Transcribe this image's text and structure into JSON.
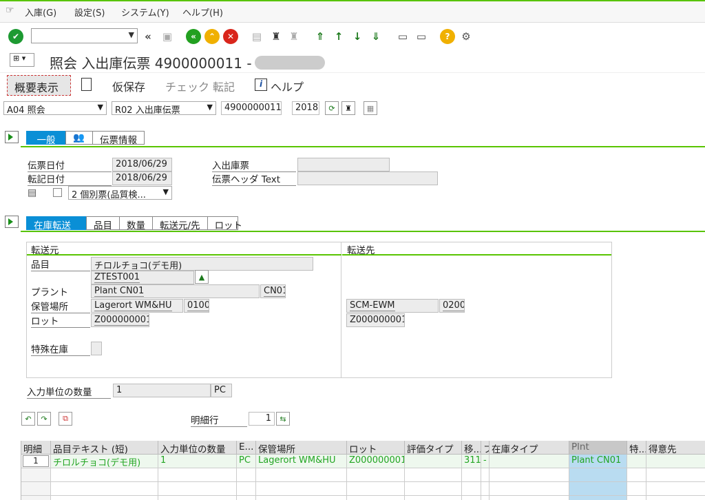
{
  "menu": {
    "items": [
      "入庫(G)",
      "設定(S)",
      "システム(Y)",
      "ヘルプ(H)"
    ]
  },
  "toolbar": {
    "command_value": ""
  },
  "title": {
    "text": "照会 入出庫伝票 4900000011 -"
  },
  "appbar": {
    "overview": "概要表示",
    "hold": "仮保存",
    "check": "チェック",
    "post": "転記",
    "help": "ヘルプ"
  },
  "header": {
    "action": "A04 照会",
    "ref_doc": "R02 入出庫伝票",
    "doc_number": "4900000011",
    "year": "2018"
  },
  "tabs_top": [
    "一般",
    "伝票情報"
  ],
  "general": {
    "doc_date_label": "伝票日付",
    "doc_date": "2018/06/29",
    "post_date_label": "転記日付",
    "post_date": "2018/06/29",
    "slip_label": "入出庫票",
    "slip_value": "",
    "header_text_label": "伝票ヘッダ Text",
    "header_text_value": "",
    "print_option": "2 個別票(品質検..."
  },
  "tabs_item": [
    "在庫転送",
    "品目",
    "数量",
    "転送元/先",
    "ロット"
  ],
  "transfer": {
    "from_title": "転送元",
    "to_title": "転送先",
    "material_label": "品目",
    "material_desc": "チロルチョコ(デモ用)",
    "material": "ZTEST001",
    "plant_label": "プラント",
    "plant_name": "Plant CN01",
    "plant": "CN01",
    "sloc_label": "保管場所",
    "sloc_name": "Lagerort WM&HU",
    "sloc": "0100",
    "batch_label": "ロット",
    "batch": "Z000000001",
    "special_stock_label": "特殊在庫",
    "to_sloc_name": "SCM-EWM",
    "to_sloc": "0200",
    "to_batch": "Z000000001"
  },
  "quantity": {
    "label": "入力単位の数量",
    "value": "1",
    "unit": "PC"
  },
  "lineitem": {
    "label": "明細行",
    "value": "1"
  },
  "grid": {
    "columns": [
      "明細",
      "品目テキスト (短)",
      "入力単位の数量",
      "E...",
      "保管場所",
      "ロット",
      "評価タイプ",
      "移...",
      "フ",
      "在庫タイプ",
      "Plnt",
      "特...",
      "得意先"
    ],
    "rows": [
      [
        "1",
        "チロルチョコ(デモ用)",
        "1",
        "PC",
        "Lagerort WM&HU",
        "Z000000001",
        "",
        "311",
        "-",
        "",
        "Plant CN01",
        "",
        ""
      ]
    ]
  },
  "colors": {
    "accent_green": "#58c400",
    "tab_blue": "#0a8fd6",
    "ok_green": "#1d9a32",
    "nav_green": "#22a020",
    "nav_yellow": "#f0b000",
    "cancel_red": "#d9261c"
  }
}
